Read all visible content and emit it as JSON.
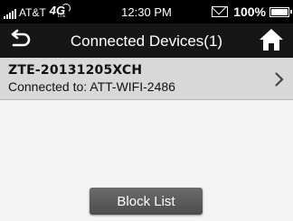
{
  "status_bar": {
    "carrier": "AT&T",
    "network_badge": "4G",
    "network_sub": "LTE",
    "time": "12:30 PM",
    "battery_percent": "100%",
    "icons": [
      "signal-icon",
      "4g-lte-icon",
      "mail-icon",
      "battery-icon"
    ]
  },
  "header": {
    "title": "Connected Devices(1)",
    "back_icon": "back-arrow-icon",
    "home_icon": "home-icon"
  },
  "devices": [
    {
      "name": "ZTE-20131205XCH",
      "connected_to": "Connected to: ATT-WIFI-2486"
    }
  ],
  "actions": {
    "block_list_label": "Block List"
  },
  "colors": {
    "status_bar_bg": "#000000",
    "header_bg": "#161616",
    "row_bg": "#d8d8d8",
    "content_bg": "#f4f4f4",
    "button_bg": "#5a5a5a"
  }
}
